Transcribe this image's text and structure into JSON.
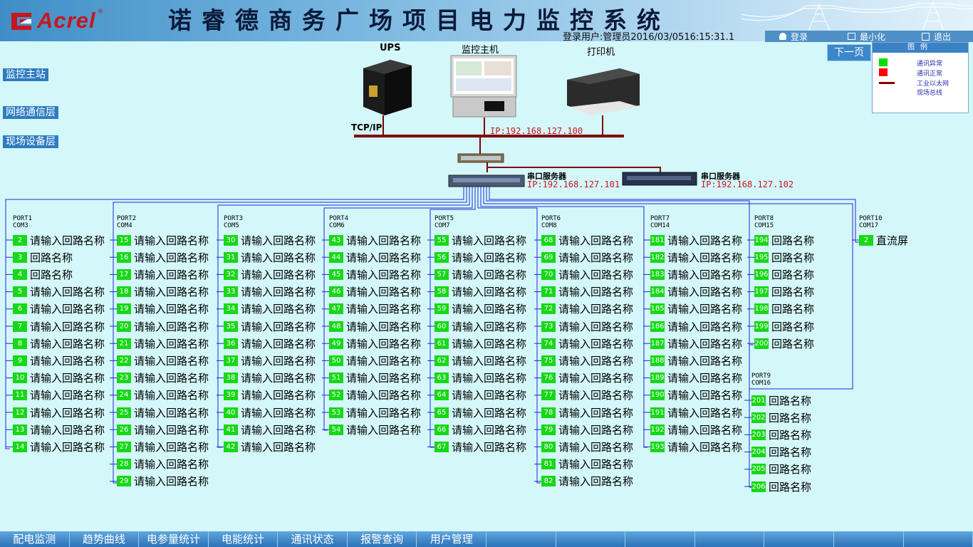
{
  "header": {
    "logo": "Acrel",
    "logo_reg": "®",
    "title": "诺睿德商务广场项目电力监控系统",
    "login_user": "登录用户:管理员",
    "datetime": "2016/03/0516:15:31.1",
    "buttons": {
      "login": "登录",
      "minimize": "最小化",
      "exit": "退出"
    }
  },
  "sidebar": {
    "items": [
      {
        "label": "监控主站"
      },
      {
        "label": "网络通信层"
      },
      {
        "label": "现场设备层"
      }
    ]
  },
  "next_page": "下一页",
  "legend": {
    "title": "图例",
    "items": [
      {
        "label": "通讯异常",
        "color": "#00e000"
      },
      {
        "label": "通讯正常",
        "color": "#ff0000"
      },
      {
        "label": "工业以太网",
        "color": "#800000"
      },
      {
        "label": "现场总线",
        "color": "#ffffff"
      }
    ]
  },
  "topology": {
    "ups": "UPS",
    "host": "监控主机",
    "printer": "打印机",
    "tcpip": "TCP/IP",
    "ip_main": "IP:192.168.127.100",
    "server1": "串口服务器",
    "ip_s1": "IP:192.168.127.101",
    "server2": "串口服务器",
    "ip_s2": "IP:192.168.127.102"
  },
  "ports": [
    {
      "port": "PORT1",
      "com": "COM3",
      "devices": [
        {
          "n": "2",
          "name": "请输入回路名称"
        },
        {
          "n": "3",
          "name": "回路名称"
        },
        {
          "n": "4",
          "name": "回路名称"
        },
        {
          "n": "5",
          "name": "请输入回路名称"
        },
        {
          "n": "6",
          "name": "请输入回路名称"
        },
        {
          "n": "7",
          "name": "请输入回路名称"
        },
        {
          "n": "8",
          "name": "请输入回路名称"
        },
        {
          "n": "9",
          "name": "请输入回路名称"
        },
        {
          "n": "10",
          "name": "请输入回路名称"
        },
        {
          "n": "11",
          "name": "请输入回路名称"
        },
        {
          "n": "12",
          "name": "请输入回路名称"
        },
        {
          "n": "13",
          "name": "请输入回路名称"
        },
        {
          "n": "14",
          "name": "请输入回路名称"
        }
      ]
    },
    {
      "port": "PORT2",
      "com": "COM4",
      "devices": [
        {
          "n": "15",
          "name": "请输入回路名称"
        },
        {
          "n": "16",
          "name": "请输入回路名称"
        },
        {
          "n": "17",
          "name": "请输入回路名称"
        },
        {
          "n": "18",
          "name": "请输入回路名称"
        },
        {
          "n": "19",
          "name": "请输入回路名称"
        },
        {
          "n": "20",
          "name": "请输入回路名称"
        },
        {
          "n": "21",
          "name": "请输入回路名称"
        },
        {
          "n": "22",
          "name": "请输入回路名称"
        },
        {
          "n": "23",
          "name": "请输入回路名称"
        },
        {
          "n": "24",
          "name": "请输入回路名称"
        },
        {
          "n": "25",
          "name": "请输入回路名称"
        },
        {
          "n": "26",
          "name": "请输入回路名称"
        },
        {
          "n": "27",
          "name": "请输入回路名称"
        },
        {
          "n": "28",
          "name": "请输入回路名称"
        },
        {
          "n": "29",
          "name": "请输入回路名称"
        }
      ]
    },
    {
      "port": "PORT3",
      "com": "COM5",
      "devices": [
        {
          "n": "30",
          "name": "请输入回路名称"
        },
        {
          "n": "31",
          "name": "请输入回路名称"
        },
        {
          "n": "32",
          "name": "请输入回路名称"
        },
        {
          "n": "33",
          "name": "请输入回路名称"
        },
        {
          "n": "34",
          "name": "请输入回路名称"
        },
        {
          "n": "35",
          "name": "请输入回路名称"
        },
        {
          "n": "36",
          "name": "请输入回路名称"
        },
        {
          "n": "37",
          "name": "请输入回路名称"
        },
        {
          "n": "38",
          "name": "请输入回路名称"
        },
        {
          "n": "39",
          "name": "请输入回路名称"
        },
        {
          "n": "40",
          "name": "请输入回路名称"
        },
        {
          "n": "41",
          "name": "请输入回路名称"
        },
        {
          "n": "42",
          "name": "请输入回路名称"
        }
      ]
    },
    {
      "port": "PORT4",
      "com": "COM6",
      "devices": [
        {
          "n": "43",
          "name": "请输入回路名称"
        },
        {
          "n": "44",
          "name": "请输入回路名称"
        },
        {
          "n": "45",
          "name": "请输入回路名称"
        },
        {
          "n": "46",
          "name": "请输入回路名称"
        },
        {
          "n": "47",
          "name": "请输入回路名称"
        },
        {
          "n": "48",
          "name": "请输入回路名称"
        },
        {
          "n": "49",
          "name": "请输入回路名称"
        },
        {
          "n": "50",
          "name": "请输入回路名称"
        },
        {
          "n": "51",
          "name": "请输入回路名称"
        },
        {
          "n": "52",
          "name": "请输入回路名称"
        },
        {
          "n": "53",
          "name": "请输入回路名称"
        },
        {
          "n": "54",
          "name": "请输入回路名称"
        }
      ]
    },
    {
      "port": "PORT5",
      "com": "COM7",
      "devices": [
        {
          "n": "55",
          "name": "请输入回路名称"
        },
        {
          "n": "56",
          "name": "请输入回路名称"
        },
        {
          "n": "57",
          "name": "请输入回路名称"
        },
        {
          "n": "58",
          "name": "请输入回路名称"
        },
        {
          "n": "59",
          "name": "请输入回路名称"
        },
        {
          "n": "60",
          "name": "请输入回路名称"
        },
        {
          "n": "61",
          "name": "请输入回路名称"
        },
        {
          "n": "62",
          "name": "请输入回路名称"
        },
        {
          "n": "63",
          "name": "请输入回路名称"
        },
        {
          "n": "64",
          "name": "请输入回路名称"
        },
        {
          "n": "65",
          "name": "请输入回路名称"
        },
        {
          "n": "66",
          "name": "请输入回路名称"
        },
        {
          "n": "67",
          "name": "请输入回路名称"
        }
      ]
    },
    {
      "port": "PORT6",
      "com": "COM8",
      "devices": [
        {
          "n": "68",
          "name": "请输入回路名称"
        },
        {
          "n": "69",
          "name": "请输入回路名称"
        },
        {
          "n": "70",
          "name": "请输入回路名称"
        },
        {
          "n": "71",
          "name": "请输入回路名称"
        },
        {
          "n": "72",
          "name": "请输入回路名称"
        },
        {
          "n": "73",
          "name": "请输入回路名称"
        },
        {
          "n": "74",
          "name": "请输入回路名称"
        },
        {
          "n": "75",
          "name": "请输入回路名称"
        },
        {
          "n": "76",
          "name": "请输入回路名称"
        },
        {
          "n": "77",
          "name": "请输入回路名称"
        },
        {
          "n": "78",
          "name": "请输入回路名称"
        },
        {
          "n": "79",
          "name": "请输入回路名称"
        },
        {
          "n": "80",
          "name": "请输入回路名称"
        },
        {
          "n": "81",
          "name": "请输入回路名称"
        },
        {
          "n": "82",
          "name": "请输入回路名称"
        }
      ]
    },
    {
      "port": "PORT7",
      "com": "COM14",
      "devices": [
        {
          "n": "181",
          "name": "请输入回路名称"
        },
        {
          "n": "182",
          "name": "请输入回路名称"
        },
        {
          "n": "183",
          "name": "请输入回路名称"
        },
        {
          "n": "184",
          "name": "请输入回路名称"
        },
        {
          "n": "185",
          "name": "请输入回路名称"
        },
        {
          "n": "186",
          "name": "请输入回路名称"
        },
        {
          "n": "187",
          "name": "请输入回路名称"
        },
        {
          "n": "188",
          "name": "请输入回路名称"
        },
        {
          "n": "189",
          "name": "请输入回路名称"
        },
        {
          "n": "190",
          "name": "请输入回路名称"
        },
        {
          "n": "191",
          "name": "请输入回路名称"
        },
        {
          "n": "192",
          "name": "请输入回路名称"
        },
        {
          "n": "193",
          "name": "请输入回路名称"
        }
      ]
    },
    {
      "port": "PORT8",
      "com": "COM15",
      "devices": [
        {
          "n": "194",
          "name": "回路名称"
        },
        {
          "n": "195",
          "name": "回路名称"
        },
        {
          "n": "196",
          "name": "回路名称"
        },
        {
          "n": "197",
          "name": "回路名称"
        },
        {
          "n": "198",
          "name": "回路名称"
        },
        {
          "n": "199",
          "name": "回路名称"
        },
        {
          "n": "200",
          "name": "回路名称"
        }
      ]
    },
    {
      "port": "PORT9",
      "com": "COM16",
      "devices": [
        {
          "n": "201",
          "name": "回路名称"
        },
        {
          "n": "202",
          "name": "回路名称"
        },
        {
          "n": "203",
          "name": "回路名称"
        },
        {
          "n": "204",
          "name": "回路名称"
        },
        {
          "n": "205",
          "name": "回路名称"
        },
        {
          "n": "206",
          "name": "回路名称"
        }
      ]
    },
    {
      "port": "PORT10",
      "com": "COM17",
      "devices": [
        {
          "n": "2",
          "name": "直流屏"
        }
      ]
    }
  ],
  "bottom_tabs": [
    {
      "label": "配电监测"
    },
    {
      "label": "趋势曲线"
    },
    {
      "label": "电参量统计"
    },
    {
      "label": "电能统计"
    },
    {
      "label": "通讯状态"
    },
    {
      "label": "报警查询"
    },
    {
      "label": "用户管理"
    },
    {
      "label": ""
    },
    {
      "label": ""
    },
    {
      "label": ""
    },
    {
      "label": ""
    },
    {
      "label": ""
    },
    {
      "label": ""
    },
    {
      "label": ""
    }
  ]
}
